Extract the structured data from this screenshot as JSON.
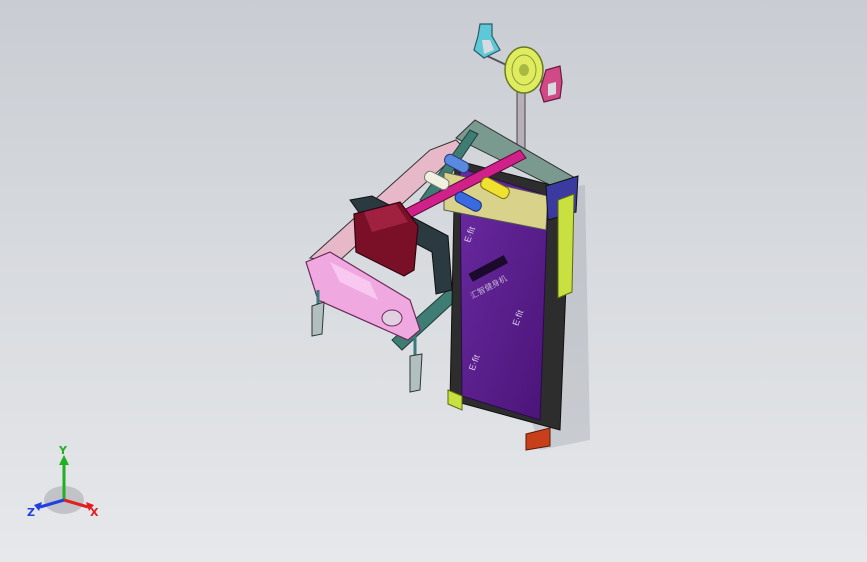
{
  "viewport": {
    "background_top": "#c9cdd3",
    "background_bottom": "#e6e8eb"
  },
  "model": {
    "deck_label": "汇智健身机",
    "logo_text": "E·fit",
    "colors": {
      "deck": "#5a1f8c",
      "frame_teal": "#3f7c73",
      "frame_pink": "#e6b8c8",
      "console_pink": "#f0a8e0",
      "seat_maroon": "#7a1028",
      "side_yellow": "#c8e040",
      "magenta_bar": "#d0208a",
      "handle_cyan": "#5fc8d8",
      "handle_pink": "#d04a88",
      "dial_yellow": "#e0ec60",
      "foot_orange": "#c8401a"
    }
  },
  "triad": {
    "x_label": "X",
    "y_label": "Y",
    "z_label": "Z",
    "x_color": "#e02020",
    "y_color": "#20b020",
    "z_color": "#2040e0"
  }
}
